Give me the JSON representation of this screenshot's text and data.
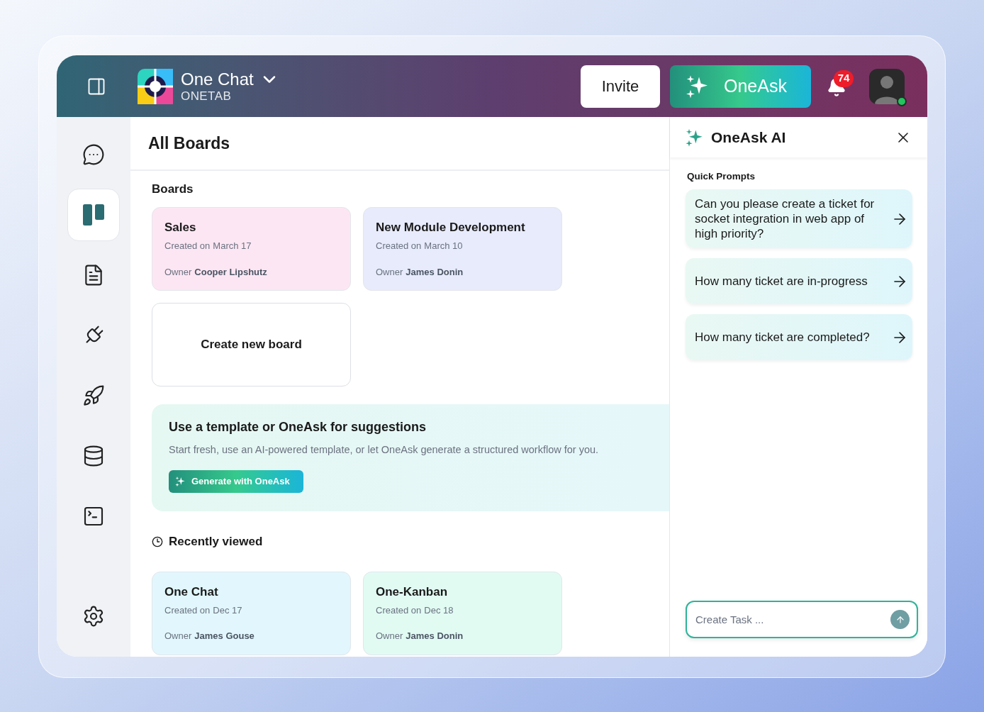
{
  "header": {
    "app_name": "One Chat",
    "workspace": "ONETAB",
    "invite_button": "Invite",
    "oneask_button": "OneAsk",
    "notification_count": "74",
    "avatar": {
      "online": true
    }
  },
  "sidebar": {
    "items": [
      {
        "selected": false
      },
      {
        "selected": true
      },
      {
        "selected": false
      },
      {
        "selected": false
      },
      {
        "selected": false
      },
      {
        "selected": false
      },
      {
        "selected": false
      },
      {
        "selected": false
      }
    ]
  },
  "page_title": "All Boards",
  "boards": {
    "heading": "Boards",
    "cards": [
      {
        "kind": "board",
        "title": "Sales",
        "created_label": "Created on",
        "created": "March 17",
        "owner_label": "Owner",
        "owner": "Cooper Lipshutz",
        "color": "#fde6f3"
      },
      {
        "kind": "board",
        "title": "New Module Development",
        "created_label": "Created on",
        "created": "March 10",
        "owner_label": "Owner",
        "owner": "James Donin",
        "color": "#e7ebfb"
      },
      {
        "kind": "create",
        "title": "Create new board"
      }
    ]
  },
  "template_banner": {
    "title": "Use a template or OneAsk for suggestions",
    "description": "Start fresh, use an AI-powered template, or let OneAsk generate a structured workflow for you.",
    "button": "Generate with OneAsk"
  },
  "recently_viewed": {
    "heading": "Recently viewed",
    "cards": [
      {
        "kind": "board",
        "title": "One Chat",
        "created_label": "Created on",
        "created": "Dec 17",
        "owner_label": "Owner",
        "owner": "James Gouse",
        "color": "#e1f7fd"
      },
      {
        "kind": "board",
        "title": "One-Kanban",
        "created_label": "Created on",
        "created": "Dec 18",
        "owner_label": "Owner",
        "owner": "James Donin",
        "color": "#e1fbf3"
      }
    ]
  },
  "assistant": {
    "title": "OneAsk AI",
    "quick_prompts_heading": "Quick Prompts",
    "prompts": [
      "Can you please create a ticket for socket integration in web app of high priority?",
      "How many ticket are in-progress",
      "How many ticket are completed?"
    ],
    "input": {
      "placeholder": "Create Task ..."
    }
  }
}
